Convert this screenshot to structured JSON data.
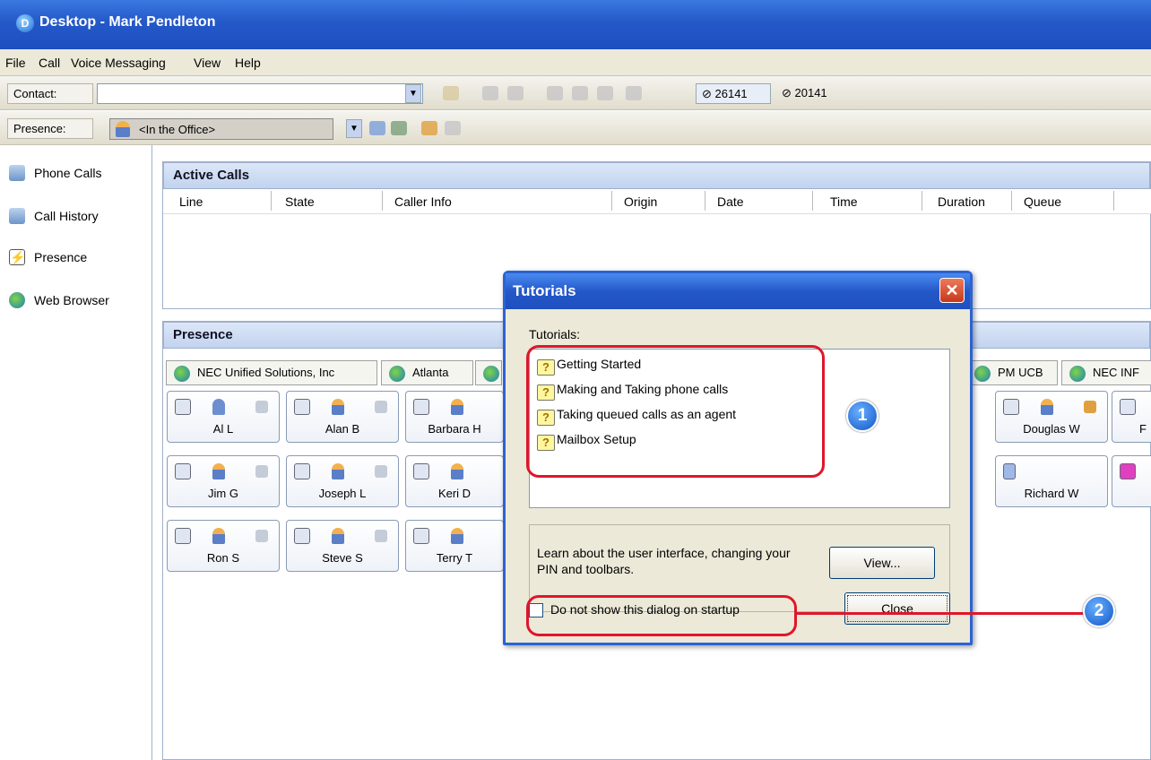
{
  "window": {
    "title": "Desktop - Mark Pendleton",
    "logo_letter": "D"
  },
  "menu": [
    "File",
    "Call",
    "Voice Messaging",
    "View",
    "Help"
  ],
  "contact_bar": {
    "label": "Contact:",
    "value": "",
    "ext1": "26141",
    "ext2": "20141"
  },
  "presence_bar": {
    "label": "Presence:",
    "value": "<In the Office>"
  },
  "sidebar": {
    "items": [
      {
        "label": "Phone Calls",
        "icon": "phone-icon"
      },
      {
        "label": "Call History",
        "icon": "call-history-icon"
      },
      {
        "label": "Presence",
        "icon": "presence-icon"
      },
      {
        "label": "Web Browser",
        "icon": "web-browser-icon"
      }
    ]
  },
  "active_calls": {
    "title": "Active Calls",
    "columns": [
      "Line",
      "State",
      "Caller Info",
      "Origin",
      "Date",
      "Time",
      "Duration",
      "Queue"
    ]
  },
  "presence_pane": {
    "title": "Presence",
    "tabs": [
      "NEC Unified Solutions, Inc",
      "Atlanta",
      "PM UCB",
      "NEC INF"
    ],
    "rows": [
      [
        "Al L",
        "Alan B",
        "Barbara H",
        "Douglas W",
        "F"
      ],
      [
        "Jim G",
        "Joseph L",
        "Keri D",
        "Richard W"
      ],
      [
        "Ron S",
        "Steve S",
        "Terry T"
      ]
    ]
  },
  "dialog": {
    "title": "Tutorials",
    "list_label": "Tutorials:",
    "items": [
      "Getting Started",
      "Making and Taking phone calls",
      "Taking queued calls as an agent",
      "Mailbox Setup"
    ],
    "description": "Learn about the user interface, changing your PIN and toolbars.",
    "view_button": "View...",
    "checkbox_label": "Do not show this dialog on startup",
    "checkbox_checked": false,
    "close_button": "Close",
    "close_x": "✕"
  },
  "callouts": [
    "1",
    "2"
  ],
  "colors": {
    "title_blue": "#2458c8",
    "callout_red": "#e0162b",
    "callout_blue": "#1056c7"
  }
}
